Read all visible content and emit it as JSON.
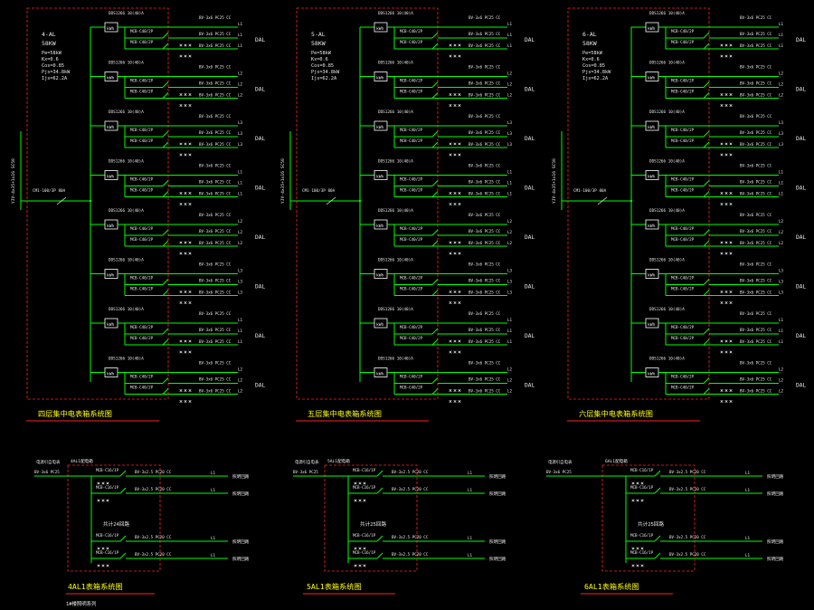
{
  "colors": {
    "background": "#000000",
    "wire": "#00ff00",
    "text": "#e8e8e8",
    "panel_border": "#ff2222",
    "title_yellow": "#ffff00",
    "title_underline": "#ff2222",
    "meter_box": "#ffffff",
    "annotation_cyan": "#00ffff"
  },
  "panels": [
    {
      "id": "4AL",
      "title": "四层集中电表箱系统图",
      "info": [
        "4-AL",
        "58KW",
        "Pe=58kW",
        "Kx=0.6",
        "Cos=0.85",
        "Pjs=34.8kW",
        "Ijs=62.2A"
      ],
      "incoming_cable": "YJV-4x35+1x16 SC50",
      "main_breaker": "CM1-100/3P 80A",
      "circuits": [
        {
          "meter": "kWh",
          "header": "DDS1266 10(40)A",
          "breaker": "MCB-C40/2P",
          "cable": "BV-3x6 PC25 CC",
          "phase": "L1",
          "load": "DAL"
        },
        {
          "meter": "kWh",
          "header": "DDS1266 10(40)A",
          "breaker": "MCB-C40/2P",
          "cable": "BV-3x6 PC25 CC",
          "phase": "L2",
          "load": "DAL"
        },
        {
          "meter": "kWh",
          "header": "DDS1266 10(40)A",
          "breaker": "MCB-C40/2P",
          "cable": "BV-3x6 PC25 CC",
          "phase": "L3",
          "load": "DAL"
        },
        {
          "meter": "kWh",
          "header": "DDS1266 10(40)A",
          "breaker": "MCB-C40/2P",
          "cable": "BV-3x6 PC25 CC",
          "phase": "L1",
          "load": "DAL"
        },
        {
          "meter": "kWh",
          "header": "DDS1266 10(40)A",
          "breaker": "MCB-C40/2P",
          "cable": "BV-3x6 PC25 CC",
          "phase": "L2",
          "load": "DAL"
        },
        {
          "meter": "kWh",
          "header": "DDS1266 10(40)A",
          "breaker": "MCB-C40/2P",
          "cable": "BV-3x6 PC25 CC",
          "phase": "L3",
          "load": "DAL"
        },
        {
          "meter": "kWh",
          "header": "DDS1266 10(40)A",
          "breaker": "MCB-C40/2P",
          "cable": "BV-3x6 PC25 CC",
          "phase": "L1",
          "load": "DAL"
        },
        {
          "meter": "kWh",
          "header": "DDS1266 10(40)A",
          "breaker": "MCB-C40/2P",
          "cable": "BV-3x6 PC25 CC",
          "phase": "L2",
          "load": "DAL"
        }
      ]
    },
    {
      "id": "5AL",
      "title": "五层集中电表箱系统图",
      "info": [
        "5-AL",
        "58KW",
        "Pe=58kW",
        "Kx=0.6",
        "Cos=0.85",
        "Pjs=34.8kW",
        "Ijs=62.2A"
      ],
      "incoming_cable": "YJV-4x35+1x16 SC50",
      "main_breaker": "CM1-100/3P 80A",
      "circuits": [
        {
          "meter": "kWh",
          "header": "DDS1266 10(40)A",
          "breaker": "MCB-C40/2P",
          "cable": "BV-3x6 PC25 CC",
          "phase": "L1",
          "load": "DAL"
        },
        {
          "meter": "kWh",
          "header": "DDS1266 10(40)A",
          "breaker": "MCB-C40/2P",
          "cable": "BV-3x6 PC25 CC",
          "phase": "L2",
          "load": "DAL"
        },
        {
          "meter": "kWh",
          "header": "DDS1266 10(40)A",
          "breaker": "MCB-C40/2P",
          "cable": "BV-3x6 PC25 CC",
          "phase": "L3",
          "load": "DAL"
        },
        {
          "meter": "kWh",
          "header": "DDS1266 10(40)A",
          "breaker": "MCB-C40/2P",
          "cable": "BV-3x6 PC25 CC",
          "phase": "L1",
          "load": "DAL"
        },
        {
          "meter": "kWh",
          "header": "DDS1266 10(40)A",
          "breaker": "MCB-C40/2P",
          "cable": "BV-3x6 PC25 CC",
          "phase": "L2",
          "load": "DAL"
        },
        {
          "meter": "kWh",
          "header": "DDS1266 10(40)A",
          "breaker": "MCB-C40/2P",
          "cable": "BV-3x6 PC25 CC",
          "phase": "L3",
          "load": "DAL"
        },
        {
          "meter": "kWh",
          "header": "DDS1266 10(40)A",
          "breaker": "MCB-C40/2P",
          "cable": "BV-3x6 PC25 CC",
          "phase": "L1",
          "load": "DAL"
        },
        {
          "meter": "kWh",
          "header": "DDS1266 10(40)A",
          "breaker": "MCB-C40/2P",
          "cable": "BV-3x6 PC25 CC",
          "phase": "L2",
          "load": "DAL"
        }
      ]
    },
    {
      "id": "6AL",
      "title": "六层集中电表箱系统图",
      "info": [
        "6-AL",
        "58KW",
        "Pe=58kW",
        "Kx=0.6",
        "Cos=0.85",
        "Pjs=34.8kW",
        "Ijs=62.2A"
      ],
      "incoming_cable": "YJV-4x35+1x16 SC50",
      "main_breaker": "CM1-100/3P 80A",
      "circuits": [
        {
          "meter": "kWh",
          "header": "DDS1266 10(40)A",
          "breaker": "MCB-C40/2P",
          "cable": "BV-3x6 PC25 CC",
          "phase": "L1",
          "load": "DAL"
        },
        {
          "meter": "kWh",
          "header": "DDS1266 10(40)A",
          "breaker": "MCB-C40/2P",
          "cable": "BV-3x6 PC25 CC",
          "phase": "L2",
          "load": "DAL"
        },
        {
          "meter": "kWh",
          "header": "DDS1266 10(40)A",
          "breaker": "MCB-C40/2P",
          "cable": "BV-3x6 PC25 CC",
          "phase": "L3",
          "load": "DAL"
        },
        {
          "meter": "kWh",
          "header": "DDS1266 10(40)A",
          "breaker": "MCB-C40/2P",
          "cable": "BV-3x6 PC25 CC",
          "phase": "L1",
          "load": "DAL"
        },
        {
          "meter": "kWh",
          "header": "DDS1266 10(40)A",
          "breaker": "MCB-C40/2P",
          "cable": "BV-3x6 PC25 CC",
          "phase": "L2",
          "load": "DAL"
        },
        {
          "meter": "kWh",
          "header": "DDS1266 10(40)A",
          "breaker": "MCB-C40/2P",
          "cable": "BV-3x6 PC25 CC",
          "phase": "L3",
          "load": "DAL"
        },
        {
          "meter": "kWh",
          "header": "DDS1266 10(40)A",
          "breaker": "MCB-C40/2P",
          "cable": "BV-3x6 PC25 CC",
          "phase": "L1",
          "load": "DAL"
        },
        {
          "meter": "kWh",
          "header": "DDS1266 10(40)A",
          "breaker": "MCB-C40/2P",
          "cable": "BV-3x6 PC25 CC",
          "phase": "L2",
          "load": "DAL"
        }
      ]
    }
  ],
  "distribution_boxes": [
    {
      "id": "4AL1",
      "title": "4AL1表箱系统图",
      "subtitle": "1#楼照明系列",
      "source_label": "电源引自电表",
      "box_label": "4AL1配电箱",
      "feeder": "BV-3x6 PC25",
      "center_label": "共计24回路",
      "circuits": [
        {
          "breaker": "MCB-C16/1P",
          "cable": "BV-3x2.5 PC20 CC",
          "phase": "L1",
          "load": "照明回路"
        },
        {
          "breaker": "MCB-C16/1P",
          "cable": "BV-3x2.5 PC20 CC",
          "phase": "L1",
          "load": "照明回路"
        },
        {
          "breaker": "MCB-C16/1P",
          "cable": "BV-3x2.5 PC20 CC",
          "phase": "L1",
          "load": "照明回路"
        },
        {
          "breaker": "MCB-C16/1P",
          "cable": "BV-3x2.5 PC20 CC",
          "phase": "L1",
          "load": "照明回路"
        }
      ]
    },
    {
      "id": "5AL1",
      "title": "5AL1表箱系统图",
      "subtitle": "",
      "source_label": "电源引自电表",
      "box_label": "5AL1配电箱",
      "feeder": "BV-3x6 PC25",
      "center_label": "共计25回路",
      "circuits": [
        {
          "breaker": "MCB-C16/1P",
          "cable": "BV-3x2.5 PC20 CC",
          "phase": "L1",
          "load": "照明回路"
        },
        {
          "breaker": "MCB-C16/1P",
          "cable": "BV-3x2.5 PC20 CC",
          "phase": "L1",
          "load": "照明回路"
        },
        {
          "breaker": "MCB-C16/1P",
          "cable": "BV-3x2.5 PC20 CC",
          "phase": "L1",
          "load": "照明回路"
        },
        {
          "breaker": "MCB-C16/1P",
          "cable": "BV-3x2.5 PC20 CC",
          "phase": "L1",
          "load": "照明回路"
        }
      ]
    },
    {
      "id": "6AL1",
      "title": "6AL1表箱系统图",
      "subtitle": "",
      "source_label": "电源引自电表",
      "box_label": "6AL1配电箱",
      "feeder": "BV-3x6 PC25",
      "center_label": "共计25回路",
      "circuits": [
        {
          "breaker": "MCB-C16/1P",
          "cable": "BV-3x2.5 PC20 CC",
          "phase": "L1",
          "load": "照明回路"
        },
        {
          "breaker": "MCB-C16/1P",
          "cable": "BV-3x2.5 PC20 CC",
          "phase": "L1",
          "load": "照明回路"
        },
        {
          "breaker": "MCB-C16/1P",
          "cable": "BV-3x2.5 PC20 CC",
          "phase": "L1",
          "load": "照明回路"
        },
        {
          "breaker": "MCB-C16/1P",
          "cable": "BV-3x2.5 PC20 CC",
          "phase": "L1",
          "load": "照明回路"
        }
      ]
    }
  ]
}
